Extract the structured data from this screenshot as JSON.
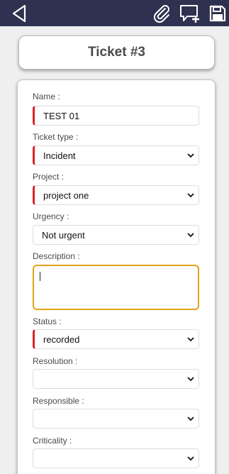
{
  "toolbar": {
    "back_icon": "back-arrow-icon",
    "attach_icon": "paperclip-icon",
    "comment_icon": "add-comment-icon",
    "save_icon": "save-icon",
    "bg_color": "#2f3150"
  },
  "header": {
    "title": "Ticket #3"
  },
  "form": {
    "name": {
      "label": "Name :",
      "value": "TEST 01"
    },
    "ticket_type": {
      "label": "Ticket type :",
      "value": "Incident"
    },
    "project": {
      "label": "Project :",
      "value": "project one"
    },
    "urgency": {
      "label": "Urgency :",
      "value": "Not urgent"
    },
    "description": {
      "label": "Description :",
      "value": ""
    },
    "status": {
      "label": "Status :",
      "value": "recorded"
    },
    "resolution": {
      "label": "Resolution :",
      "value": ""
    },
    "responsible": {
      "label": "Responsible :",
      "value": ""
    },
    "criticality": {
      "label": "Criticality :",
      "value": ""
    }
  },
  "colors": {
    "required": "#d9232b",
    "focus": "#e0a11b"
  }
}
